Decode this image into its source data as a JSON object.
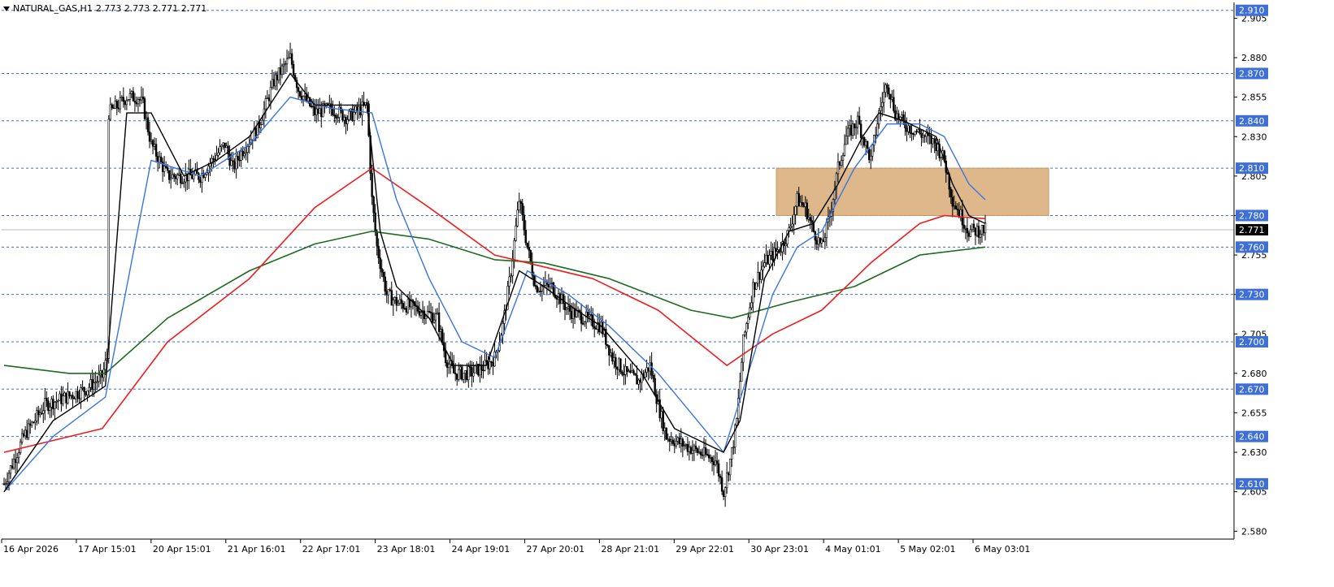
{
  "header": {
    "symbol": "NATURAL_GAS,H1",
    "ohlc": "2.773 2.773 2.771 2.771"
  },
  "colors": {
    "background": "#ffffff",
    "level_line": "#3d6fd6",
    "level_label_bg": "#3d6fd6",
    "price_label_bg": "#000000",
    "ma_fast": "#000000",
    "ma_mid": "#3b74e0",
    "ma_slow": "#ee1c1c",
    "ma_long": "#1f6b1f",
    "zone": "#dcb485"
  },
  "chart_data": {
    "type": "candlestick",
    "symbol": "NATURAL_GAS",
    "timeframe": "H1",
    "y_tick_labels": [
      "2.905",
      "2.880",
      "2.855",
      "2.830",
      "2.805",
      "2.780",
      "2.755",
      "2.730",
      "2.705",
      "2.680",
      "2.655",
      "2.630",
      "2.605",
      "2.580"
    ],
    "x_tick_labels": [
      "16 Apr 2026",
      "17 Apr 15:01",
      "20 Apr 15:01",
      "21 Apr 16:01",
      "22 Apr 17:01",
      "23 Apr 18:01",
      "24 Apr 19:01",
      "27 Apr 20:01",
      "28 Apr 21:01",
      "29 Apr 22:01",
      "30 Apr 23:01",
      "4 May 01:01",
      "5 May 02:01",
      "6 May 03:01"
    ],
    "levels": [
      "2.910",
      "2.870",
      "2.840",
      "2.810",
      "2.780",
      "2.760",
      "2.730",
      "2.700",
      "2.670",
      "2.640",
      "2.610"
    ],
    "current_price": "2.771",
    "ylim": [
      2.575,
      2.915
    ],
    "zone": {
      "from": 2.78,
      "to": 2.81
    },
    "close_path": [
      [
        0,
        2.61
      ],
      [
        12,
        2.64
      ],
      [
        25,
        2.66
      ],
      [
        38,
        2.665
      ],
      [
        50,
        2.67
      ],
      [
        60,
        2.678
      ],
      [
        63,
        2.69
      ],
      [
        64,
        2.845
      ],
      [
        70,
        2.85
      ],
      [
        75,
        2.855
      ],
      [
        82,
        2.855
      ],
      [
        85,
        2.85
      ],
      [
        90,
        2.825
      ],
      [
        100,
        2.805
      ],
      [
        120,
        2.805
      ],
      [
        125,
        2.812
      ],
      [
        135,
        2.825
      ],
      [
        140,
        2.81
      ],
      [
        145,
        2.82
      ],
      [
        155,
        2.835
      ],
      [
        165,
        2.865
      ],
      [
        175,
        2.88
      ],
      [
        180,
        2.86
      ],
      [
        190,
        2.845
      ],
      [
        200,
        2.848
      ],
      [
        210,
        2.842
      ],
      [
        222,
        2.85
      ],
      [
        225,
        2.79
      ],
      [
        228,
        2.76
      ],
      [
        234,
        2.73
      ],
      [
        240,
        2.725
      ],
      [
        255,
        2.72
      ],
      [
        265,
        2.715
      ],
      [
        270,
        2.69
      ],
      [
        275,
        2.68
      ],
      [
        285,
        2.68
      ],
      [
        295,
        2.685
      ],
      [
        300,
        2.69
      ],
      [
        305,
        2.71
      ],
      [
        310,
        2.745
      ],
      [
        315,
        2.79
      ],
      [
        320,
        2.76
      ],
      [
        325,
        2.735
      ],
      [
        335,
        2.735
      ],
      [
        345,
        2.72
      ],
      [
        355,
        2.715
      ],
      [
        365,
        2.71
      ],
      [
        372,
        2.69
      ],
      [
        380,
        2.68
      ],
      [
        388,
        2.675
      ],
      [
        395,
        2.685
      ],
      [
        400,
        2.66
      ],
      [
        405,
        2.64
      ],
      [
        415,
        2.635
      ],
      [
        425,
        2.63
      ],
      [
        435,
        2.625
      ],
      [
        440,
        2.605
      ],
      [
        445,
        2.63
      ],
      [
        448,
        2.65
      ],
      [
        452,
        2.7
      ],
      [
        458,
        2.735
      ],
      [
        465,
        2.75
      ],
      [
        475,
        2.76
      ],
      [
        480,
        2.77
      ],
      [
        485,
        2.79
      ],
      [
        490,
        2.785
      ],
      [
        495,
        2.77
      ],
      [
        500,
        2.76
      ],
      [
        505,
        2.78
      ],
      [
        510,
        2.81
      ],
      [
        515,
        2.83
      ],
      [
        522,
        2.84
      ],
      [
        530,
        2.815
      ],
      [
        535,
        2.845
      ],
      [
        540,
        2.865
      ],
      [
        545,
        2.845
      ],
      [
        550,
        2.838
      ],
      [
        560,
        2.832
      ],
      [
        570,
        2.825
      ],
      [
        575,
        2.815
      ],
      [
        580,
        2.79
      ],
      [
        585,
        2.78
      ],
      [
        590,
        2.77
      ],
      [
        600,
        2.771
      ]
    ],
    "ma_fast": [
      [
        0,
        2.605
      ],
      [
        30,
        2.65
      ],
      [
        62,
        2.672
      ],
      [
        75,
        2.845
      ],
      [
        90,
        2.845
      ],
      [
        110,
        2.805
      ],
      [
        130,
        2.815
      ],
      [
        150,
        2.83
      ],
      [
        175,
        2.87
      ],
      [
        190,
        2.85
      ],
      [
        222,
        2.85
      ],
      [
        230,
        2.77
      ],
      [
        240,
        2.735
      ],
      [
        260,
        2.715
      ],
      [
        275,
        2.685
      ],
      [
        295,
        2.685
      ],
      [
        315,
        2.745
      ],
      [
        330,
        2.735
      ],
      [
        350,
        2.72
      ],
      [
        365,
        2.71
      ],
      [
        390,
        2.68
      ],
      [
        410,
        2.645
      ],
      [
        440,
        2.63
      ],
      [
        450,
        2.65
      ],
      [
        465,
        2.74
      ],
      [
        480,
        2.77
      ],
      [
        495,
        2.775
      ],
      [
        510,
        2.8
      ],
      [
        525,
        2.83
      ],
      [
        535,
        2.845
      ],
      [
        550,
        2.84
      ],
      [
        570,
        2.83
      ],
      [
        580,
        2.8
      ],
      [
        590,
        2.78
      ],
      [
        600,
        2.775
      ]
    ],
    "ma_mid": [
      [
        0,
        2.605
      ],
      [
        30,
        2.64
      ],
      [
        62,
        2.665
      ],
      [
        90,
        2.815
      ],
      [
        120,
        2.805
      ],
      [
        150,
        2.825
      ],
      [
        175,
        2.855
      ],
      [
        200,
        2.848
      ],
      [
        225,
        2.845
      ],
      [
        240,
        2.79
      ],
      [
        260,
        2.74
      ],
      [
        280,
        2.7
      ],
      [
        300,
        2.69
      ],
      [
        320,
        2.745
      ],
      [
        345,
        2.73
      ],
      [
        370,
        2.71
      ],
      [
        400,
        2.68
      ],
      [
        440,
        2.63
      ],
      [
        455,
        2.68
      ],
      [
        470,
        2.73
      ],
      [
        485,
        2.76
      ],
      [
        500,
        2.77
      ],
      [
        520,
        2.81
      ],
      [
        540,
        2.838
      ],
      [
        560,
        2.838
      ],
      [
        575,
        2.83
      ],
      [
        590,
        2.8
      ],
      [
        600,
        2.79
      ]
    ],
    "ma_slow": [
      [
        0,
        2.63
      ],
      [
        60,
        2.645
      ],
      [
        100,
        2.7
      ],
      [
        150,
        2.74
      ],
      [
        190,
        2.785
      ],
      [
        225,
        2.81
      ],
      [
        260,
        2.785
      ],
      [
        300,
        2.755
      ],
      [
        320,
        2.75
      ],
      [
        360,
        2.74
      ],
      [
        400,
        2.72
      ],
      [
        442,
        2.685
      ],
      [
        470,
        2.705
      ],
      [
        500,
        2.72
      ],
      [
        530,
        2.75
      ],
      [
        560,
        2.775
      ],
      [
        575,
        2.78
      ],
      [
        600,
        2.778
      ]
    ],
    "ma_long": [
      [
        0,
        2.685
      ],
      [
        40,
        2.68
      ],
      [
        62,
        2.68
      ],
      [
        100,
        2.715
      ],
      [
        150,
        2.745
      ],
      [
        190,
        2.762
      ],
      [
        225,
        2.77
      ],
      [
        260,
        2.765
      ],
      [
        300,
        2.752
      ],
      [
        330,
        2.75
      ],
      [
        370,
        2.74
      ],
      [
        420,
        2.72
      ],
      [
        445,
        2.715
      ],
      [
        480,
        2.725
      ],
      [
        520,
        2.735
      ],
      [
        560,
        2.755
      ],
      [
        600,
        2.76
      ]
    ]
  }
}
